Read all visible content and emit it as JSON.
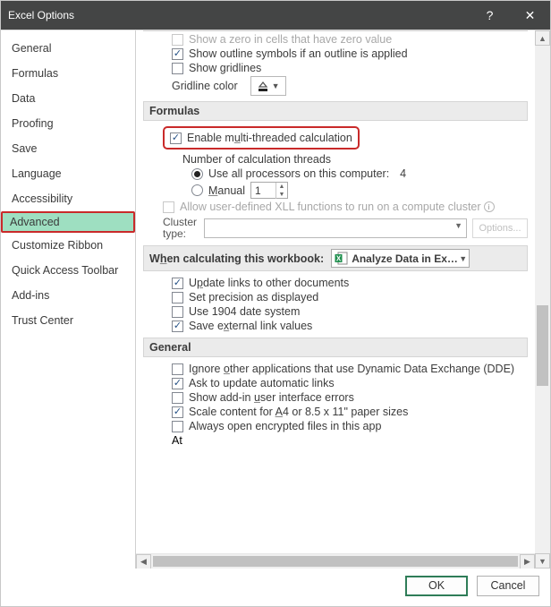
{
  "title": "Excel Options",
  "nav": [
    "General",
    "Formulas",
    "Data",
    "Proofing",
    "Save",
    "Language",
    "Accessibility",
    "Advanced",
    "Customize Ribbon",
    "Quick Access Toolbar",
    "Add-ins",
    "Trust Center"
  ],
  "truncated_top": "Show a zero in cells that have zero value",
  "show_outline": "Show outline symbols if an outline is applied",
  "show_gridlines": "Show gridlines",
  "gridline_color": "Gridline color",
  "sec_formulas": "Formulas",
  "enable_mt_pre": "Enable m",
  "enable_mt_u": "u",
  "enable_mt_post": "lti-threaded calculation",
  "num_threads": "Number of calculation threads",
  "use_all": "Use all processors on this computer:",
  "cpu_count": "4",
  "manual_u": "M",
  "manual_rest": "anual",
  "manual_val": "1",
  "allow_xll": "Allow user-defined XLL functions to run on a compute cluster",
  "cluster_type": "Cluster type:",
  "options_btn": "Options...",
  "sec_calc_pre": "W",
  "sec_calc_u": "h",
  "sec_calc_post": "en calculating this workbook:",
  "workbook": "Analyze Data in Exc…",
  "update_links_pre": "U",
  "update_links_u": "p",
  "update_links_post": "date links to other documents",
  "set_precision": "Set precision as displayed",
  "use_1904": "Use 1904 date system",
  "save_ext_pre": "Save e",
  "save_ext_u": "x",
  "save_ext_post": "ternal link values",
  "sec_general": "General",
  "ignore_dde_pre": "Ignore ",
  "ignore_dde_u": "o",
  "ignore_dde_post": "ther applications that use Dynamic Data Exchange (DDE)",
  "ask_update": "Ask to update automatic links",
  "show_addin_pre": "Show add-in ",
  "show_addin_u": "u",
  "show_addin_post": "ser interface errors",
  "scale_content_pre": "Scale content for ",
  "scale_content_u": "A",
  "scale_content_post": "4 or 8.5 x 11\" paper sizes",
  "always_open": "Always open encrypted files in this app",
  "at": "At",
  "ok": "OK",
  "cancel": "Cancel"
}
